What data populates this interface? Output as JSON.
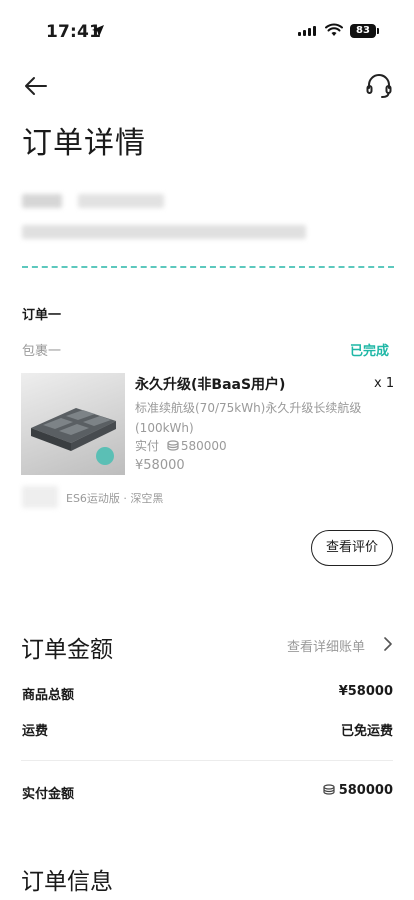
{
  "status_bar": {
    "time": "17:41",
    "battery": "83"
  },
  "page": {
    "title": "订单详情"
  },
  "order": {
    "label": "订单一",
    "package_label": "包裹一",
    "status": "已完成",
    "product": {
      "name": "永久升级(非BaaS用户)",
      "quantity": "x 1",
      "spec": "标准续航级(70/75kWh)永久升级长续航级(100kWh)",
      "paid_label": "实付",
      "paid_value": "580000",
      "price": "¥58000",
      "variant": "ES6运动版 · 深空黑"
    },
    "review_button": "查看评价"
  },
  "amount": {
    "title": "订单金额",
    "detail_link": "查看详细账单",
    "rows": [
      {
        "label": "商品总额",
        "value": "¥58000"
      },
      {
        "label": "运费",
        "value": "已免运费"
      }
    ],
    "total_label": "实付金额",
    "total_value": "580000"
  },
  "info": {
    "title": "订单信息"
  },
  "colors": {
    "accent": "#1fb7a6",
    "dash": "#5cc8bd"
  }
}
